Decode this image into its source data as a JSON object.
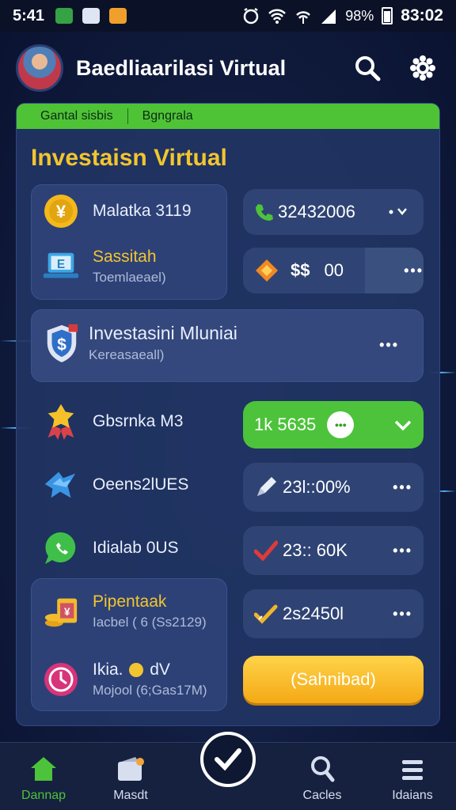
{
  "status_bar": {
    "time": "5:41",
    "battery": "98%",
    "clock": "83:02"
  },
  "header": {
    "title": "Baedliaarilasi Virtual"
  },
  "tabs": [
    "Gantal sisbis",
    "Bgngrala"
  ],
  "section_title": "Investaisn Virtual",
  "panel_a": {
    "item1": "Malatka 3119",
    "item2_title": "Sassitah",
    "item2_sub": "Toemlaeael)"
  },
  "panel_b": {
    "title": "Investasini Mluniai",
    "sub": "Kereasaeall)"
  },
  "values": {
    "phone": "32432006",
    "coins": "00",
    "coins_prefix": "$$",
    "green": "1k 5635",
    "percent": "23l::00%",
    "k": "23:: 60K",
    "pen": "2s2450l"
  },
  "list": {
    "item1": "Gbsrnka M3",
    "item2": "Oeens2lUES",
    "item3": "Idialab 0US"
  },
  "panel_c": {
    "item1_title": "Pipentaak",
    "item1_sub": "Iacbel ( 6 (Ss2129)",
    "item2_title": "Ikia.",
    "item2_title_suffix": "dV",
    "item2_sub": "Mojool (6;Gas17M)"
  },
  "action_button": "(Sahnibad)",
  "bottom_nav": [
    "Dannap",
    "Masdt",
    "Cacles",
    "Idaians"
  ],
  "colors": {
    "accent_green": "#4cc33a",
    "accent_yellow": "#f2c530",
    "card": "#213463"
  }
}
